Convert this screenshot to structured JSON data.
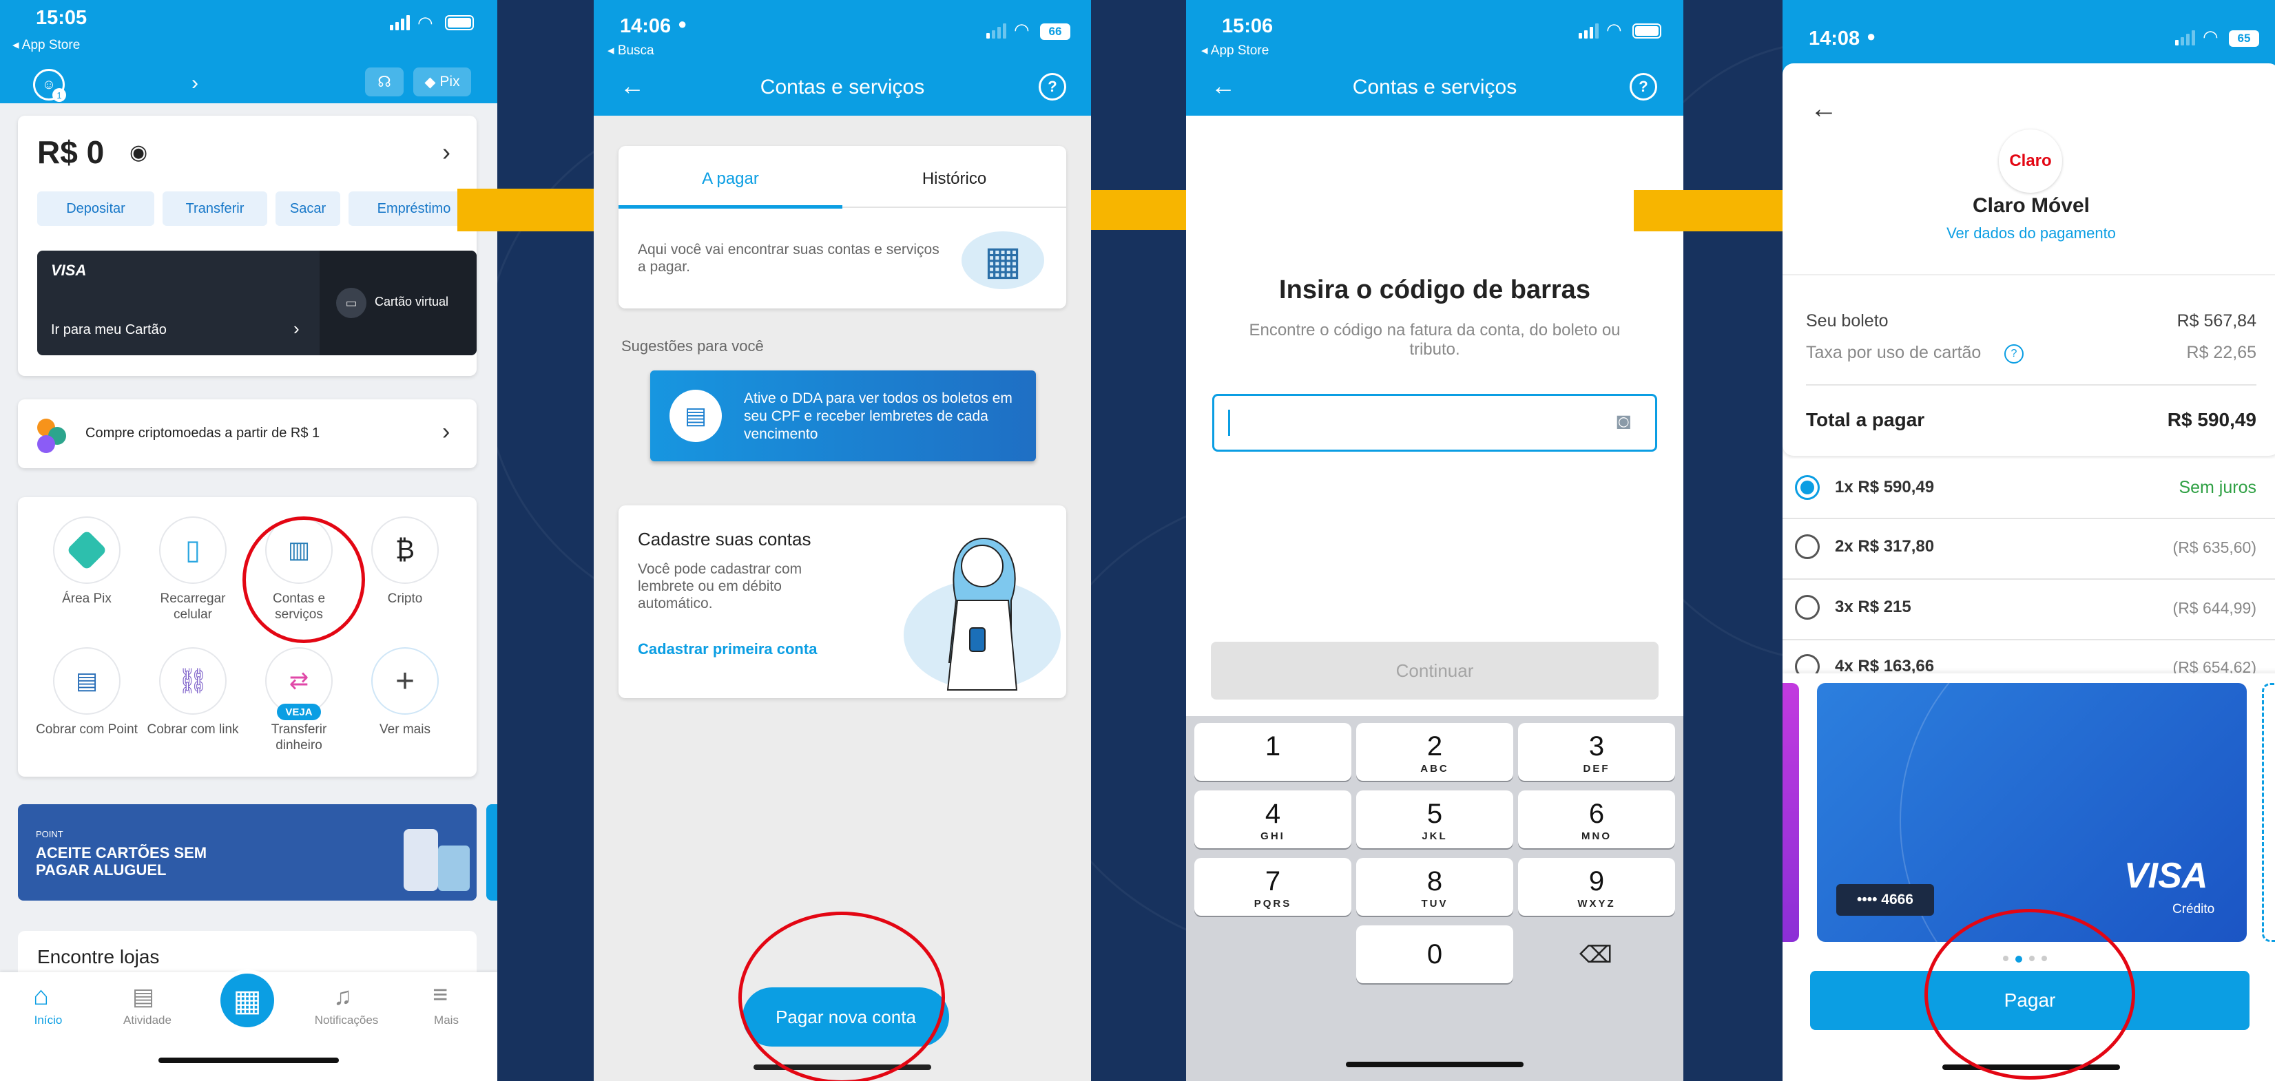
{
  "colors": {
    "blue": "#0b9ee3",
    "navy_bg": "#17325e",
    "arrow": "#f7b500",
    "highlight": "#e30613",
    "card_dark": "#232a35"
  },
  "screen1": {
    "time": "15:05",
    "back": "◂ App Store",
    "pix": "Pix",
    "balance": "R$ 0",
    "actions": [
      "Depositar",
      "Transferir",
      "Sacar",
      "Empréstimo"
    ],
    "card_brand": "VISA",
    "card_link": "Ir para meu Cartão",
    "virtual": "Cartão virtual",
    "crypto": "Compre criptomoedas a partir de R$ 1",
    "grid": [
      {
        "label": "Área Pix",
        "icon": "pix-icon"
      },
      {
        "label": "Recarregar celular",
        "icon": "phone-recharge-icon"
      },
      {
        "label": "Contas e serviços",
        "icon": "barcode-icon"
      },
      {
        "label": "Cripto",
        "icon": "bitcoin-icon"
      },
      {
        "label": "Cobrar com Point",
        "icon": "point-device-icon"
      },
      {
        "label": "Cobrar com link",
        "icon": "link-icon"
      },
      {
        "label": "Transferir dinheiro",
        "icon": "transfer-icon"
      },
      {
        "label": "Ver mais",
        "icon": "plus-icon"
      }
    ],
    "badge": "VEJA",
    "banner_small": "POINT",
    "banner_title": "ACEITE CARTÕES SEM PAGAR ALUGUEL",
    "stores": "Encontre lojas",
    "nav": [
      "Início",
      "Atividade",
      "Notificações",
      "Mais"
    ]
  },
  "screen2": {
    "time": "14:06",
    "back": "◂ Busca",
    "battery": "66",
    "title": "Contas e serviços",
    "tabs": [
      "A pagar",
      "Histórico"
    ],
    "info": "Aqui você vai encontrar suas contas e serviços a pagar.",
    "suggestions": "Sugestões para você",
    "dda": "Ative o DDA para ver todos os boletos em seu CPF e receber lembretes de cada vencimento",
    "register_title": "Cadastre suas contas",
    "register_text": "Você pode cadastrar com lembrete ou em débito automático.",
    "register_link": "Cadastrar primeira conta",
    "pay_button": "Pagar nova conta"
  },
  "screen3": {
    "time": "15:06",
    "back": "◂ App Store",
    "title": "Contas e serviços",
    "heading": "Insira o código de barras",
    "subtitle": "Encontre o código na fatura da conta, do boleto ou tributo.",
    "input_value": "",
    "continue": "Continuar",
    "keys": [
      {
        "d": "1",
        "l": ""
      },
      {
        "d": "2",
        "l": "ABC"
      },
      {
        "d": "3",
        "l": "DEF"
      },
      {
        "d": "4",
        "l": "GHI"
      },
      {
        "d": "5",
        "l": "JKL"
      },
      {
        "d": "6",
        "l": "MNO"
      },
      {
        "d": "7",
        "l": "PQRS"
      },
      {
        "d": "8",
        "l": "TUV"
      },
      {
        "d": "9",
        "l": "WXYZ"
      },
      {
        "d": "0",
        "l": ""
      }
    ]
  },
  "screen4": {
    "time": "14:08",
    "battery": "65",
    "brand": "Claro",
    "merchant": "Claro Móvel",
    "view_data": "Ver dados do pagamento",
    "boleto_label": "Seu boleto",
    "boleto_value": "R$ 567,84",
    "fee_label": "Taxa por uso de cartão",
    "fee_value": "R$ 22,65",
    "total_label": "Total a pagar",
    "total_value": "R$ 590,49",
    "installments": [
      {
        "left": "1x R$ 590,49",
        "right": "Sem juros",
        "selected": true
      },
      {
        "left": "2x R$ 317,80",
        "right": "(R$ 635,60)",
        "selected": false
      },
      {
        "left": "3x R$ 215",
        "right": "(R$ 644,99)",
        "selected": false
      },
      {
        "left": "4x R$ 163,66",
        "right": "(R$ 654,62)",
        "selected": false
      }
    ],
    "card_last4": "•••• 4666",
    "card_brand": "VISA",
    "card_type": "Crédito",
    "carousel_selected": 1,
    "pay": "Pagar"
  }
}
